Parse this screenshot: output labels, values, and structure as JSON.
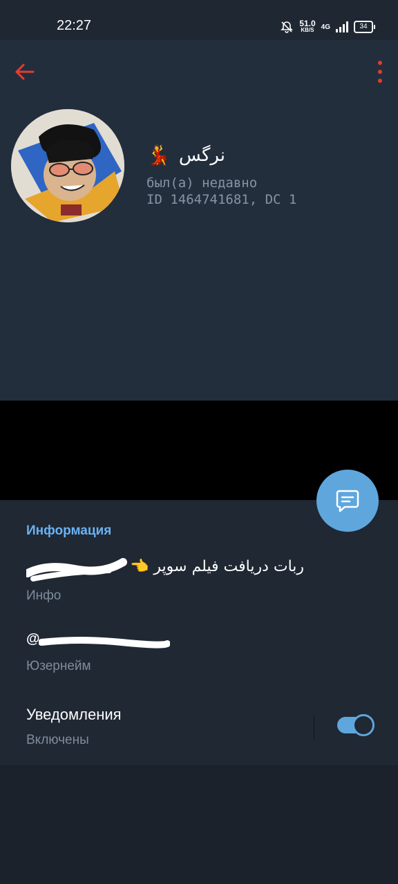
{
  "status_bar": {
    "time": "22:27",
    "speed_value": "51.0",
    "speed_unit": "KB/S",
    "network": "4G",
    "battery": "34"
  },
  "header": {
    "name": "نرگس",
    "name_emoji": "💃",
    "last_seen": "был(а) недавно",
    "id_line": "ID 1464741681, DC 1"
  },
  "info": {
    "section_title": "Информация",
    "bio": "ربات دریافت فیلم سوپر",
    "bio_emoji": "👈",
    "bio_label": "Инфо",
    "username_prefix": "@",
    "username_label": "Юзернейм",
    "notifications_title": "Уведомления",
    "notifications_status": "Включены"
  },
  "colors": {
    "accent": "#5fa6dd",
    "back_arrow": "#e33d31",
    "section_title": "#6ab2f2"
  }
}
